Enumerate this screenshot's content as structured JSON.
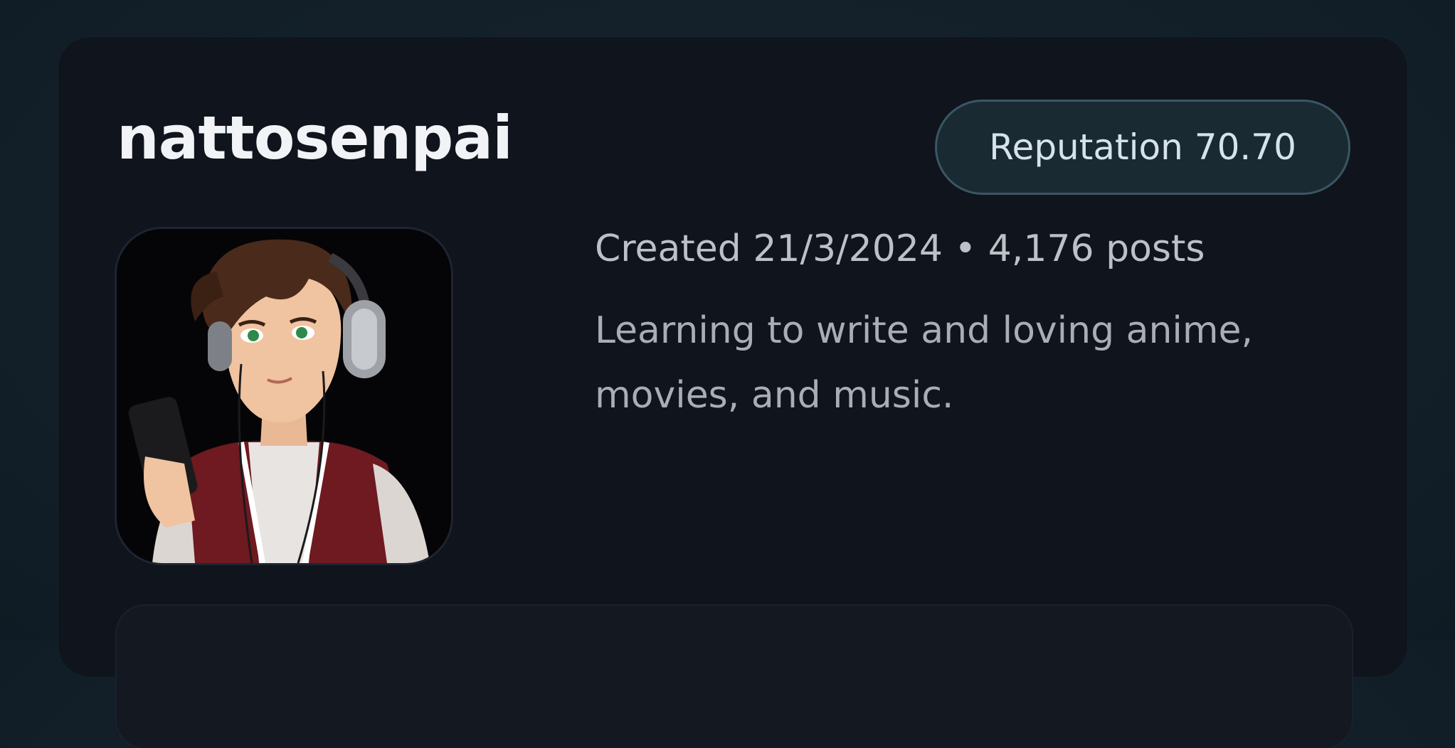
{
  "profile": {
    "username": "nattosenpai",
    "reputation_label": "Reputation",
    "reputation_value": "70.70",
    "created_label": "Created",
    "created_date": "21/3/2024",
    "separator": "•",
    "posts_count": "4,176",
    "posts_label": "posts",
    "bio_lines": [
      "Learning to write and loving anime,",
      "movies, and music."
    ]
  },
  "colors": {
    "background": "#13202a",
    "card": "#10141c",
    "badge_border": "#3b5665",
    "badge_text": "#d5e3ec"
  }
}
